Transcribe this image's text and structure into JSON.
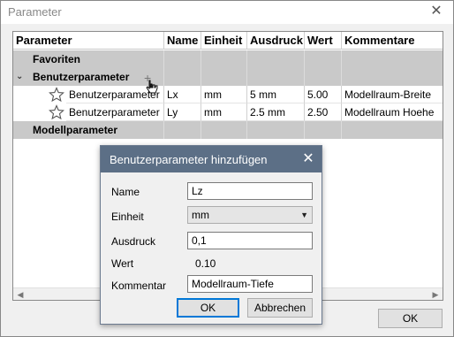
{
  "window": {
    "title": "Parameter",
    "ok_label": "OK"
  },
  "table": {
    "headers": [
      "Parameter",
      "Name",
      "Einheit",
      "Ausdruck",
      "Wert",
      "Kommentare"
    ],
    "groups": {
      "favorites": "Favoriten",
      "user": "Benutzerparameter",
      "model": "Modellparameter"
    },
    "rows": [
      {
        "parameter": "Benutzerparameter",
        "name": "Lx",
        "unit": "mm",
        "expression": "5 mm",
        "value": "5.00",
        "comment": "Modellraum-Breite"
      },
      {
        "parameter": "Benutzerparameter",
        "name": "Ly",
        "unit": "mm",
        "expression": "2.5 mm",
        "value": "2.50",
        "comment": "Modellraum Hoehe"
      }
    ]
  },
  "dialog": {
    "title": "Benutzerparameter hinzufügen",
    "name_label": "Name",
    "name_value": "Lz",
    "unit_label": "Einheit",
    "unit_value": "mm",
    "expression_label": "Ausdruck",
    "expression_value": "0,1",
    "value_label": "Wert",
    "value_value": "0.10",
    "comment_label": "Kommentar",
    "comment_value": "Modellraum-Tiefe",
    "ok_label": "OK",
    "cancel_label": "Abbrechen"
  },
  "icons": {
    "close": "close-icon",
    "star": "star-icon",
    "add": "plus-icon",
    "expand": "chevron-down-icon",
    "dropdown": "caret-down-icon"
  },
  "colors": {
    "dialog_title_bg": "#5c6f86",
    "group_row_bg": "#c9c9c9",
    "focus_border": "#0078d7"
  }
}
